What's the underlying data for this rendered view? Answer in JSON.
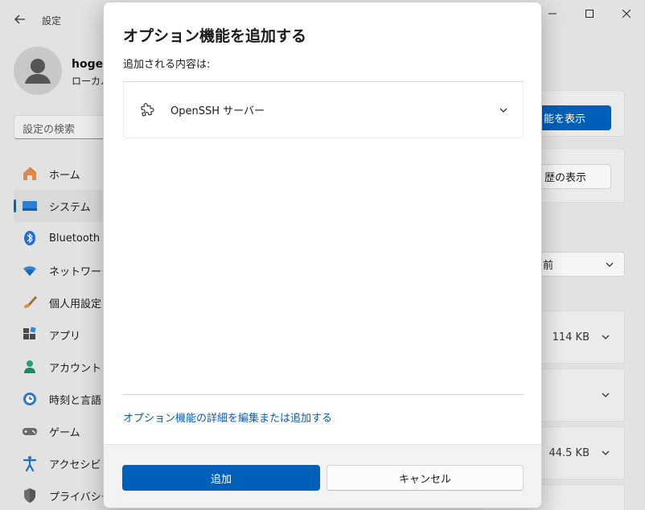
{
  "app": {
    "title": "設定"
  },
  "profile": {
    "name": "hogeh",
    "account_type": "ローカル"
  },
  "search": {
    "placeholder": "設定の検索"
  },
  "sidebar": {
    "items": [
      {
        "label": "ホーム",
        "icon": "home-icon"
      },
      {
        "label": "システム",
        "icon": "system-icon",
        "selected": true
      },
      {
        "label": "Bluetooth a",
        "icon": "bluetooth-icon"
      },
      {
        "label": "ネットワークと",
        "icon": "network-icon"
      },
      {
        "label": "個人用設定",
        "icon": "personalization-icon"
      },
      {
        "label": "アプリ",
        "icon": "apps-icon"
      },
      {
        "label": "アカウント",
        "icon": "account-icon"
      },
      {
        "label": "時刻と言語",
        "icon": "time-language-icon"
      },
      {
        "label": "ゲーム",
        "icon": "gaming-icon"
      },
      {
        "label": "アクセシビリテ",
        "icon": "accessibility-icon"
      },
      {
        "label": "プライバシーと",
        "icon": "privacy-icon"
      }
    ]
  },
  "background_content": {
    "view_features_button": "能を表示",
    "history_button": "歴の表示",
    "sort_dropdown": "前",
    "sizes": [
      "114 KB",
      "",
      "44.5 KB"
    ]
  },
  "dialog": {
    "title": "オプション機能を追加する",
    "subtitle": "追加される内容は:",
    "features": [
      {
        "name": "OpenSSH サーバー",
        "icon": "puzzle-icon"
      }
    ],
    "link": "オプション機能の詳細を編集または追加する",
    "add_button": "追加",
    "cancel_button": "キャンセル"
  },
  "colors": {
    "accent": "#005fb8",
    "link": "#0b5cab",
    "background": "#e2e2e2",
    "dialog_footer": "#f3f3f3"
  }
}
